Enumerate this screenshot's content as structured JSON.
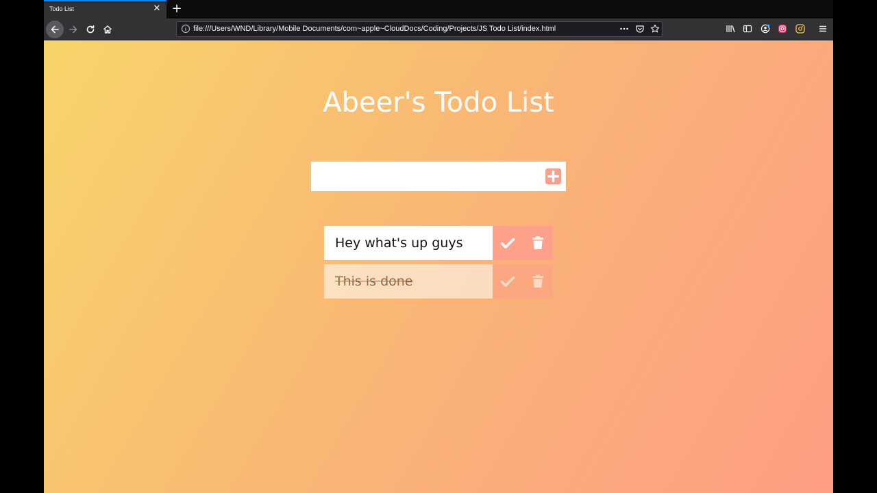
{
  "browser": {
    "tab_title": "Todo List",
    "tab_close_glyph": "✕",
    "new_tab_glyph": "+",
    "url": "file:///Users/WND/Library/Mobile Documents/com~apple~CloudDocs/Coding/Projects/JS Todo List/index.html",
    "icons": [
      "back-arrow-icon",
      "forward-arrow-icon",
      "reload-icon",
      "home-icon",
      "info-icon",
      "more-icon",
      "pocket-icon",
      "star-icon",
      "library-icon",
      "sidebar-icon",
      "account-icon",
      "instagram-icon",
      "instagram-icon",
      "menu-icon"
    ]
  },
  "app": {
    "title": "Abeer's Todo List",
    "input": {
      "value": "",
      "placeholder": ""
    },
    "add_icon": "plus-square-icon",
    "todos": [
      {
        "text": "Hey what's up guys",
        "completed": false
      },
      {
        "text": "This is done",
        "completed": true
      }
    ],
    "colors": {
      "gradient_start": "#f7d56a",
      "gradient_end": "#fd9d84",
      "accent": "#fda18a"
    }
  }
}
